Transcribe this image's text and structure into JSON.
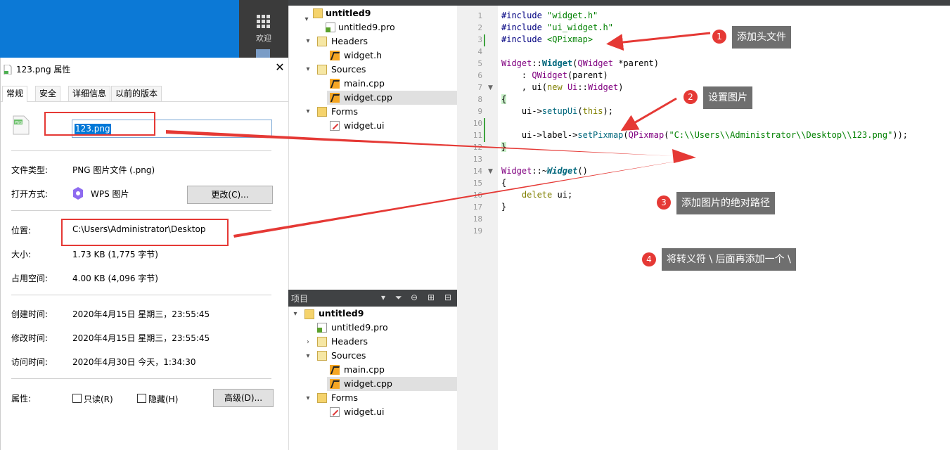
{
  "taskbar": {
    "welcome_label": "欢迎"
  },
  "dialog": {
    "title": "123.png 属性",
    "tabs": [
      "常规",
      "安全",
      "详细信息",
      "以前的版本"
    ],
    "file_name": "123.png",
    "file_type_label": "文件类型:",
    "file_type_value": "PNG 图片文件 (.png)",
    "open_with_label": "打开方式:",
    "open_with_value": "WPS 图片",
    "change_button": "更改(C)...",
    "location_label": "位置:",
    "location_value": "C:\\Users\\Administrator\\Desktop",
    "size_label": "大小:",
    "size_value": "1.73 KB (1,775 字节)",
    "disk_size_label": "占用空间:",
    "disk_size_value": "4.00 KB (4,096 字节)",
    "created_label": "创建时间:",
    "created_value": "2020年4月15日 星期三，23:55:45",
    "modified_label": "修改时间:",
    "modified_value": "2020年4月15日 星期三，23:55:45",
    "accessed_label": "访问时间:",
    "accessed_value": "2020年4月30日 今天，1:34:30",
    "attributes_label": "属性:",
    "readonly_label": "只读(R)",
    "hidden_label": "隐藏(H)",
    "advanced_button": "高级(D)..."
  },
  "project_tree_top": {
    "root": "untitled9",
    "pro_file": "untitled9.pro",
    "headers": "Headers",
    "header_file": "widget.h",
    "sources": "Sources",
    "source_main": "main.cpp",
    "source_widget": "widget.cpp",
    "forms": "Forms",
    "form_file": "widget.ui"
  },
  "project_tree_bottom": {
    "header_label": "项目",
    "root": "untitled9",
    "pro_file": "untitled9.pro",
    "headers": "Headers",
    "sources": "Sources",
    "source_main": "main.cpp",
    "source_widget": "widget.cpp",
    "forms": "Forms",
    "form_file": "widget.ui"
  },
  "editor": {
    "line_numbers": [
      "1",
      "2",
      "3",
      "4",
      "5",
      "6",
      "7",
      "8",
      "9",
      "10",
      "11",
      "12",
      "13",
      "14",
      "15",
      "16",
      "17",
      "18",
      "19"
    ],
    "lines": {
      "l1a": "#include ",
      "l1b": "\"widget.h\"",
      "l2a": "#include ",
      "l2b": "\"ui_widget.h\"",
      "l3a": "#include ",
      "l3b": "<QPixmap>",
      "l5a": "Widget",
      "l5b": "::",
      "l5c": "Widget",
      "l5d": "(",
      "l5e": "QWidget",
      "l5f": " *parent)",
      "l6a": "    : ",
      "l6b": "QWidget",
      "l6c": "(parent)",
      "l7a": "    , ui(",
      "l7b": "new",
      "l7c": " ",
      "l7d": "Ui",
      "l7e": "::",
      "l7f": "Widget",
      "l7g": ")",
      "l8": "{",
      "l9a": "    ui->",
      "l9b": "setupUi",
      "l9c": "(",
      "l9d": "this",
      "l9e": ");",
      "l11a": "    ui->label->",
      "l11b": "setPixmap",
      "l11c": "(",
      "l11d": "QPixmap",
      "l11e": "(",
      "l11f": "\"C:\\\\Users\\\\Administrator\\\\Desktop\\\\123.png\"",
      "l11g": "));",
      "l12": "}",
      "l14a": "Widget",
      "l14b": "::~",
      "l14c": "Widget",
      "l14d": "()",
      "l15": "{",
      "l16a": "    ",
      "l16b": "delete",
      "l16c": " ui;",
      "l17": "}"
    }
  },
  "annotations": [
    {
      "num": "1",
      "text": "添加头文件"
    },
    {
      "num": "2",
      "text": "设置图片"
    },
    {
      "num": "3",
      "text": "添加图片的绝对路径"
    },
    {
      "num": "4",
      "text": "将转义符 \\ 后面再添加一个 \\"
    }
  ],
  "colors": {
    "annotation_red": "#e53935",
    "annotation_label_bg": "#6f6f6f",
    "selection_blue": "#0078d7"
  }
}
